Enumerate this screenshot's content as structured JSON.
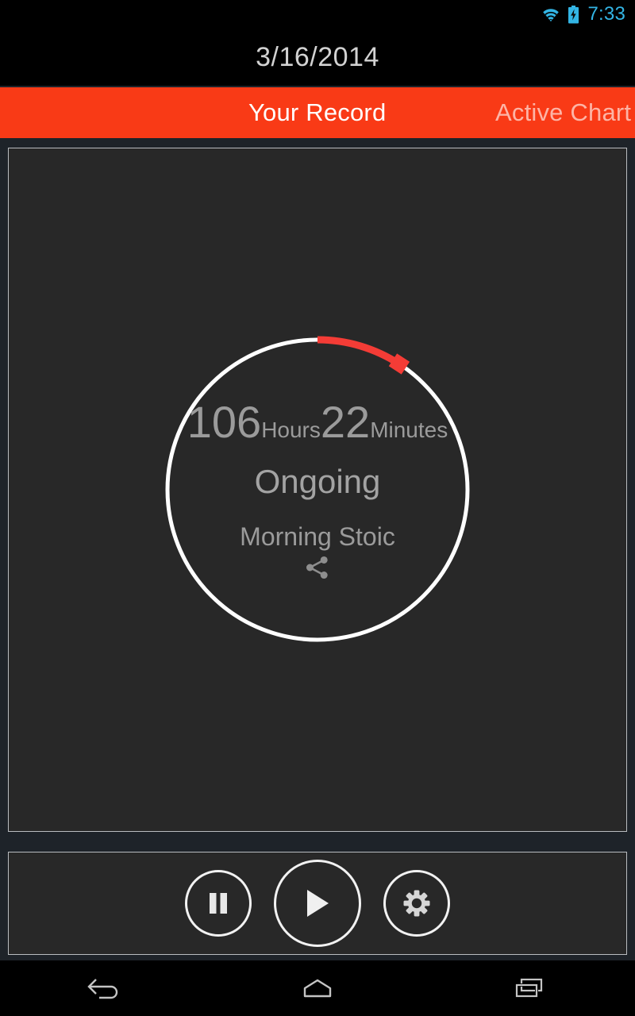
{
  "status_bar": {
    "time": "7:33",
    "wifi_icon": "wifi-icon",
    "battery_icon": "battery-charging-icon",
    "accent_color": "#33b5e5"
  },
  "header": {
    "title": "3/16/2014"
  },
  "tabs": {
    "accent_color": "#f93a16",
    "items": [
      {
        "label": "Your Record",
        "active": true
      },
      {
        "label": "Active Chart",
        "active": false
      }
    ]
  },
  "record": {
    "hours_value": "106",
    "hours_unit": "Hours",
    "minutes_value": "22",
    "minutes_unit": "Minutes",
    "status": "Ongoing",
    "session_name": "Morning Stoic",
    "share_icon": "share-icon",
    "gauge": {
      "track_color": "#ffffff",
      "progress_color": "#f43c36",
      "progress_degrees": 33,
      "marker": "progress-marker"
    }
  },
  "controls": {
    "pause_label": "Pause",
    "play_label": "Play",
    "settings_label": "Settings"
  },
  "nav_bar": {
    "back_label": "Back",
    "home_label": "Home",
    "recents_label": "Recent apps"
  }
}
